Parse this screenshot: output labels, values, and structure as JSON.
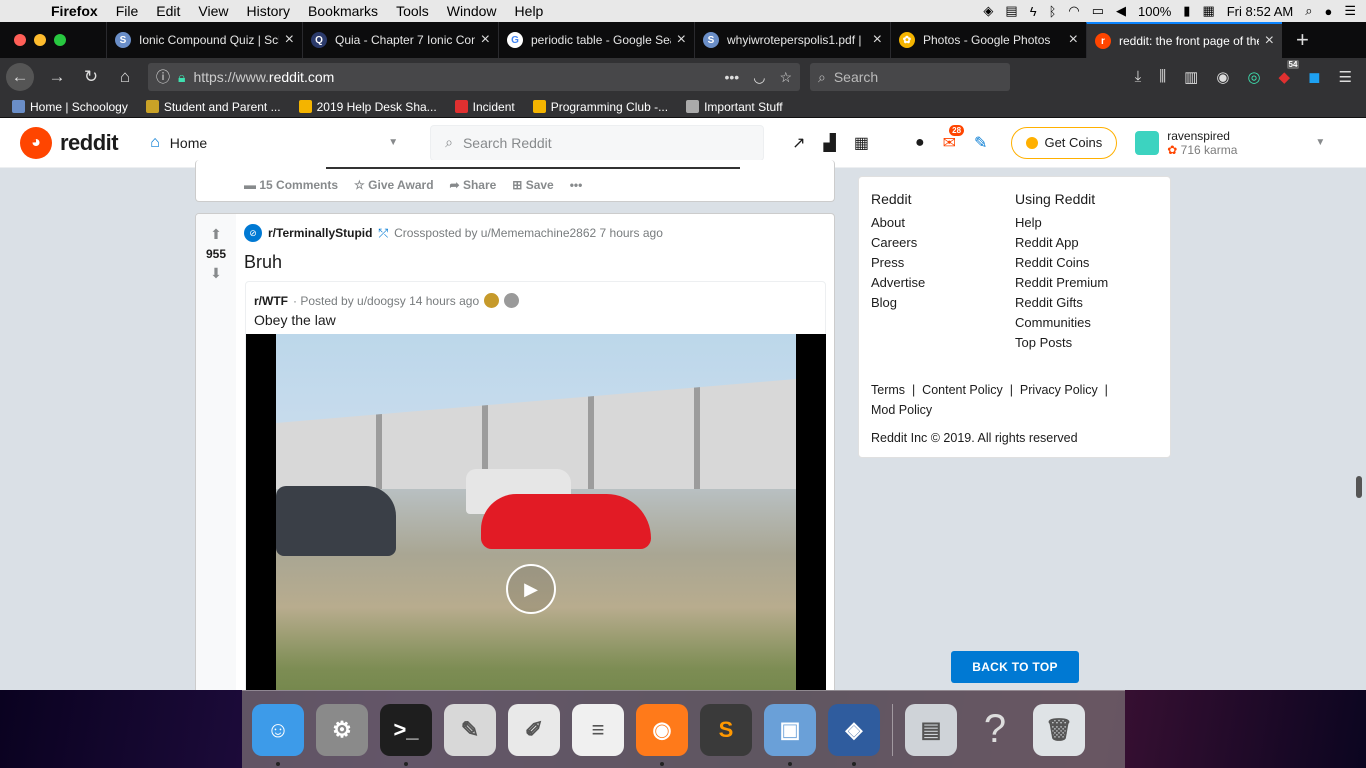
{
  "menubar": {
    "app": "Firefox",
    "items": [
      "File",
      "Edit",
      "View",
      "History",
      "Bookmarks",
      "Tools",
      "Window",
      "Help"
    ],
    "battery": "100%",
    "clock": "Fri 8:52 AM"
  },
  "tabs": [
    {
      "title": "Ionic Compound Quiz | Sch",
      "icon_color": "#6a8ec8",
      "icon_glyph": "S"
    },
    {
      "title": "Quia - Chapter 7 Ionic Com",
      "icon_color": "#2b3a6b",
      "icon_glyph": "Q"
    },
    {
      "title": "periodic table - Google Sea",
      "icon_color": "#ffffff",
      "icon_glyph": "G"
    },
    {
      "title": "whyiwroteperspolis1.pdf |",
      "icon_color": "#6a8ec8",
      "icon_glyph": "S"
    },
    {
      "title": "Photos - Google Photos",
      "icon_color": "#f4b400",
      "icon_glyph": "✿"
    },
    {
      "title": "reddit: the front page of the",
      "icon_color": "#ff4500",
      "icon_glyph": "r",
      "active": true
    }
  ],
  "navbar": {
    "url_prefix": "https://www.",
    "url_domain": "reddit.com",
    "search_placeholder": "Search",
    "badge_count": "54"
  },
  "bookmarks": [
    {
      "label": "Home | Schoology",
      "color": "#6a8ec8"
    },
    {
      "label": "Student and Parent ...",
      "color": "#c9a227"
    },
    {
      "label": "2019 Help Desk Sha...",
      "color": "#f4b400"
    },
    {
      "label": "Incident",
      "color": "#e03030"
    },
    {
      "label": "Programming Club -...",
      "color": "#f4b400"
    },
    {
      "label": "Important Stuff",
      "color": "#aaaaaa"
    }
  ],
  "reddit_header": {
    "logo_text": "reddit",
    "home_label": "Home",
    "search_placeholder": "Search Reddit",
    "notification_count": "28",
    "coins_label": "Get Coins",
    "username": "ravenspired",
    "karma": "716 karma"
  },
  "post_prev": {
    "comments": "15 Comments",
    "give_award": "Give Award",
    "share": "Share",
    "save": "Save",
    "more": "•••"
  },
  "post": {
    "score": "955",
    "subreddit": "r/TerminallyStupid",
    "crosspost_meta": "Crossposted by u/Mememachine2862 7 hours ago",
    "title": "Bruh",
    "original": {
      "subreddit": "r/WTF",
      "meta": "· Posted by u/doogsy 14 hours ago",
      "title": "Obey the law"
    }
  },
  "sidebar": {
    "col1_title": "Reddit",
    "col1_items": [
      "About",
      "Careers",
      "Press",
      "Advertise",
      "Blog"
    ],
    "col2_title": "Using Reddit",
    "col2_items": [
      "Help",
      "Reddit App",
      "Reddit Coins",
      "Reddit Premium",
      "Reddit Gifts",
      "Communities",
      "Top Posts"
    ],
    "legal": [
      "Terms",
      "Content Policy",
      "Privacy Policy",
      "Mod Policy"
    ],
    "copyright": "Reddit Inc © 2019. All rights reserved"
  },
  "back_to_top": "BACK TO TOP",
  "dock": [
    {
      "name": "finder-icon",
      "color": "#3d9be9",
      "glyph": "☺",
      "running": true
    },
    {
      "name": "system-preferences-icon",
      "color": "#8a8a8a",
      "glyph": "⚙",
      "running": false
    },
    {
      "name": "terminal-icon",
      "color": "#1e1e1e",
      "glyph": ">_",
      "running": true
    },
    {
      "name": "script-editor-icon",
      "color": "#d8d8d8",
      "glyph": "✎",
      "running": false
    },
    {
      "name": "textedit-icon",
      "color": "#e9e9e9",
      "glyph": "✐",
      "running": false
    },
    {
      "name": "notes-icon",
      "color": "#f0f0f0",
      "glyph": "≡",
      "running": false
    },
    {
      "name": "firefox-icon",
      "color": "#ff7a1a",
      "glyph": "◉",
      "running": true
    },
    {
      "name": "sublime-text-icon",
      "color": "#3a3a3a",
      "glyph": "S",
      "running": false
    },
    {
      "name": "preview-icon",
      "color": "#6aa0d8",
      "glyph": "▣",
      "running": true
    },
    {
      "name": "virtualbox-icon",
      "color": "#2f5c9e",
      "glyph": "◈",
      "running": true
    },
    {
      "name": "documents-icon",
      "color": "#cfd3d8",
      "glyph": "▤",
      "running": false
    },
    {
      "name": "unknown-app-icon",
      "color": "transparent",
      "glyph": "?",
      "running": false
    },
    {
      "name": "trash-icon",
      "color": "#dfe3e6",
      "glyph": "🗑",
      "running": false
    }
  ]
}
